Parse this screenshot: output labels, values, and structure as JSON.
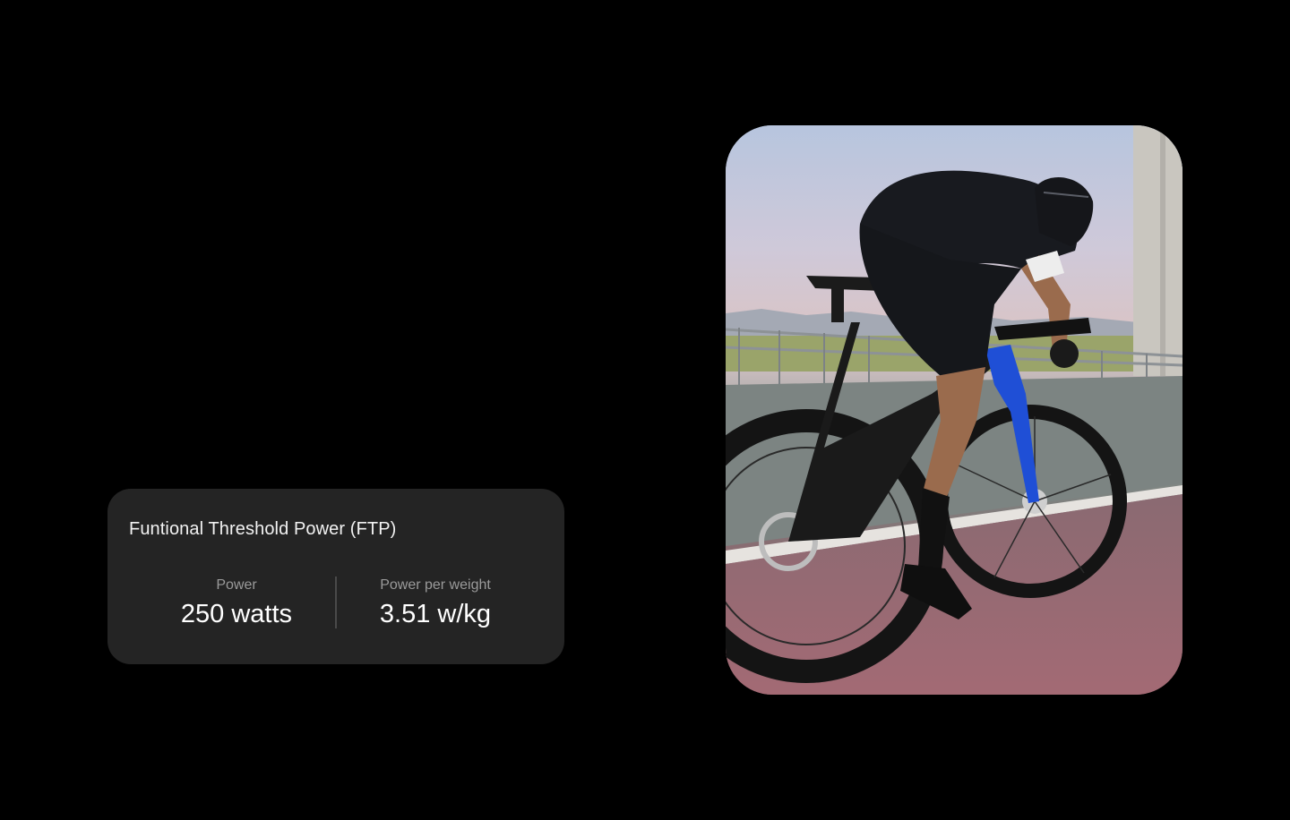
{
  "ftp_card": {
    "title": "Funtional Threshold Power (FTP)",
    "metrics": [
      {
        "label": "Power",
        "value": "250 watts"
      },
      {
        "label": "Power per weight",
        "value": "3.51 w/kg"
      }
    ]
  },
  "photo": {
    "subject": "cyclist-riding-road-bike-image"
  },
  "colors": {
    "background": "#000000",
    "card": "#242424",
    "label": "#9a9a9a",
    "value": "#ffffff"
  }
}
